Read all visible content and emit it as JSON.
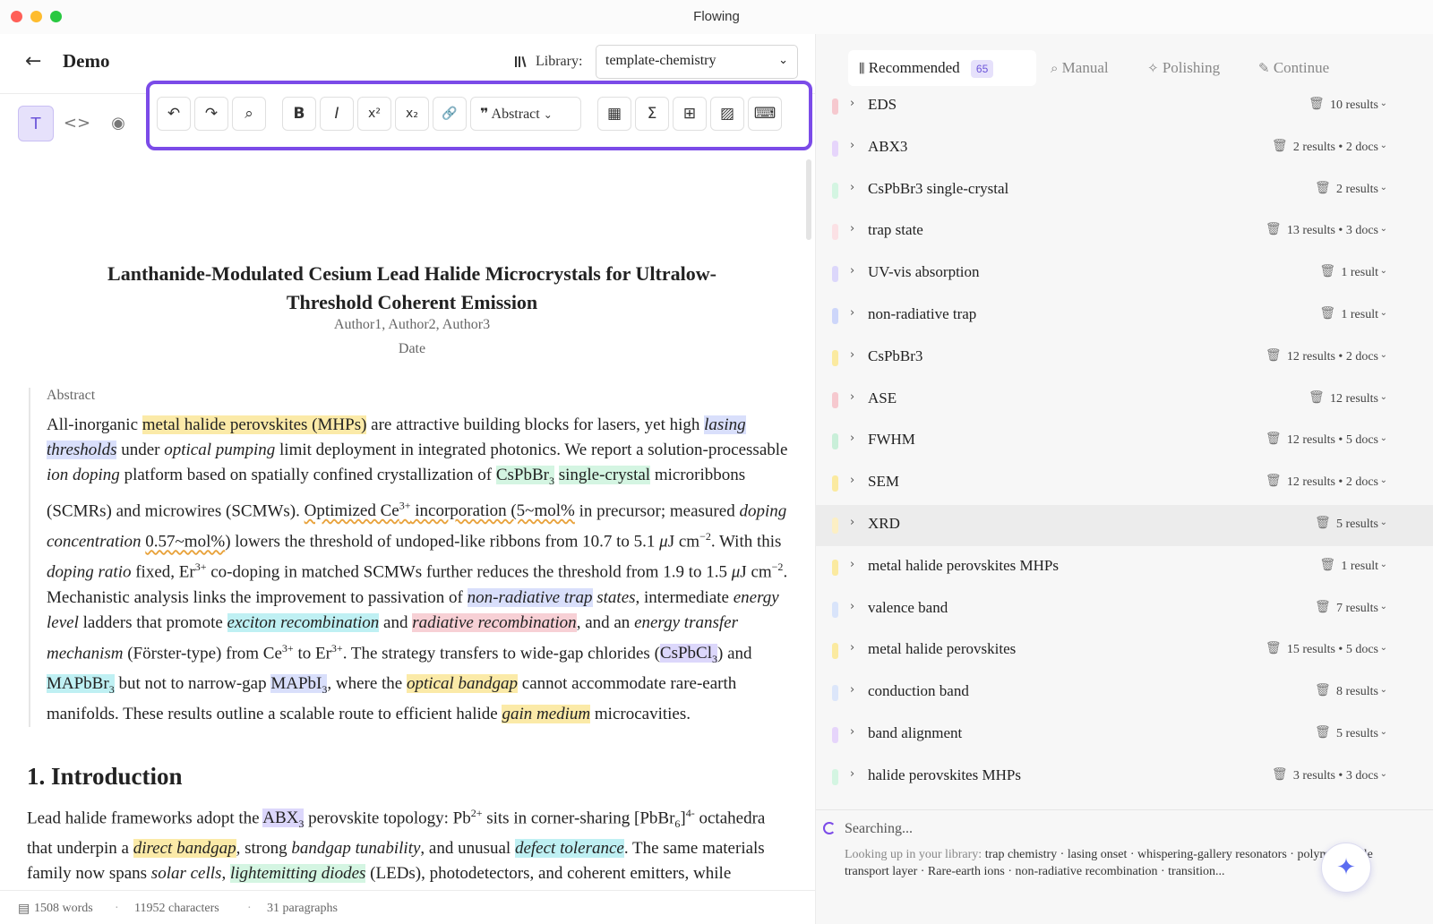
{
  "window": {
    "title": "Flowing"
  },
  "header": {
    "back_icon": "←",
    "doc_title": "Demo",
    "library_label": "Library:",
    "library_value": "template-chemistry"
  },
  "modes": [
    {
      "glyph": "T",
      "icon": "text-mode-icon"
    },
    {
      "glyph": "<>",
      "icon": "code-mode-icon"
    },
    {
      "glyph": "◉",
      "icon": "preview-mode-icon"
    }
  ],
  "toolbar": {
    "undo": "↶",
    "redo": "↷",
    "search": "⌕",
    "bold": "B",
    "italic": "I",
    "superscript": "x²",
    "subscript": "x₂",
    "link": "🔗",
    "block_style": "Abstract",
    "calc": "▦",
    "sigma": "Σ",
    "table": "⊞",
    "image": "▨",
    "keyboard": "⌨"
  },
  "paper": {
    "title_line1": "Lanthanide-Modulated Cesium Lead Halide Microcrystals for Ultralow-",
    "title_line2": "Threshold Coherent Emission",
    "authors": "Author1, Author2, Author3",
    "date": "Date",
    "abstract_label": "Abstract",
    "intro_heading": "1. Introduction"
  },
  "status": {
    "words": "1508 words",
    "characters": "11952 characters",
    "paragraphs": "31 paragraphs"
  },
  "panel": {
    "tabs": [
      {
        "label": "Recommended",
        "badge": "65"
      },
      {
        "label": "Manual"
      },
      {
        "label": "Polishing"
      },
      {
        "label": "Continue"
      }
    ],
    "items": [
      {
        "label": "EDS",
        "count": "10 results",
        "color": "#f6c9cf"
      },
      {
        "label": "ABX3",
        "count": "2 results • 2 docs",
        "color": "#e6d5fb"
      },
      {
        "label": "CsPbBr3 single-crystal",
        "count": "2 results",
        "color": "#d4f5e2"
      },
      {
        "label": "trap state",
        "count": "13 results • 3 docs",
        "color": "#fbe1e5"
      },
      {
        "label": "UV-vis absorption",
        "count": "1 result",
        "color": "#dcd7fb"
      },
      {
        "label": "non-radiative trap",
        "count": "1 result",
        "color": "#cdd6fa"
      },
      {
        "label": "CsPbBr3",
        "count": "12 results • 2 docs",
        "color": "#fbeaa0"
      },
      {
        "label": "ASE",
        "count": "12 results",
        "color": "#f6c9cf"
      },
      {
        "label": "FWHM",
        "count": "12 results • 5 docs",
        "color": "#c9efd9"
      },
      {
        "label": "SEM",
        "count": "12 results • 2 docs",
        "color": "#fbeaa0"
      },
      {
        "label": "XRD",
        "count": "5 results",
        "color": "#fcefc4"
      },
      {
        "label": "metal halide perovskites MHPs",
        "count": "1 result",
        "color": "#fbeaa0"
      },
      {
        "label": "valence band",
        "count": "7 results",
        "color": "#d9e4fa"
      },
      {
        "label": "metal halide perovskites",
        "count": "15 results • 5 docs",
        "color": "#fbeaa0"
      },
      {
        "label": "conduction band",
        "count": "8 results",
        "color": "#dce6fa"
      },
      {
        "label": "band alignment",
        "count": "5 results",
        "color": "#e6d5fb"
      },
      {
        "label": "halide perovskites MHPs",
        "count": "3 results • 3 docs",
        "color": "#d4f5e2"
      }
    ],
    "searching_label": "Searching...",
    "lookup_prefix": "Looking up in your library:",
    "lookup_terms": "trap chemistry · lasing onset · whispering-gallery resonators · polymeric hole transport layer · Rare-earth ions · non-radiative recombination · transition..."
  }
}
